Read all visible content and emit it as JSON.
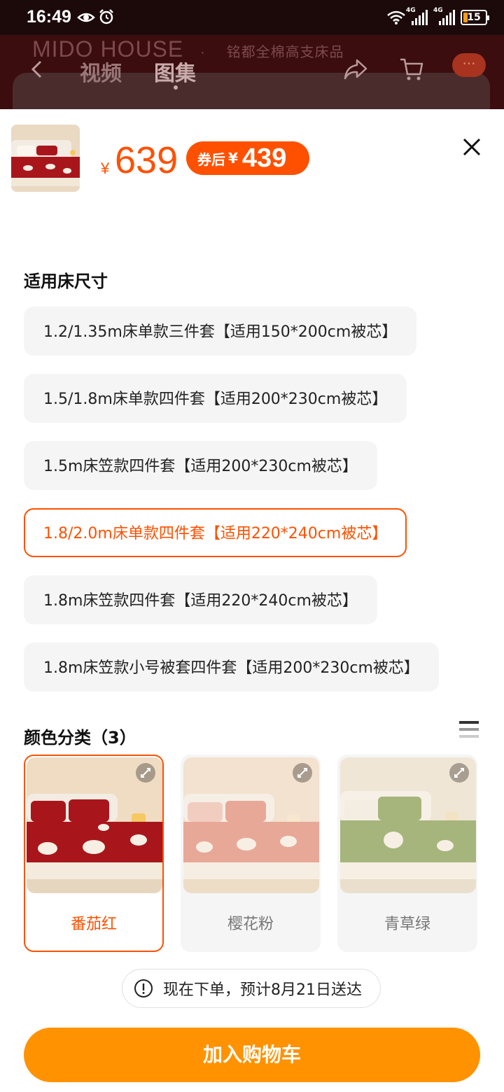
{
  "status_bar": {
    "time": "16:49",
    "net1": "4G",
    "net2": "4G",
    "battery": "15"
  },
  "background": {
    "brand": "MIDO HOUSE",
    "brand_sub": "铭都全棉高支床品",
    "tabs": [
      "视频",
      "图集"
    ],
    "more": "···"
  },
  "product": {
    "currency": "¥",
    "price": "639",
    "coupon_label": "券后",
    "coupon_currency": "¥",
    "coupon_price": "439"
  },
  "size_section": {
    "title": "适用床尺寸",
    "options": [
      {
        "label": "1.2/1.35m床单款三件套【适用150*200cm被芯】",
        "selected": false
      },
      {
        "label": "1.5/1.8m床单款四件套【适用200*230cm被芯】",
        "selected": false
      },
      {
        "label": "1.5m床笠款四件套【适用200*230cm被芯】",
        "selected": false
      },
      {
        "label": "1.8/2.0m床单款四件套【适用220*240cm被芯】",
        "selected": true
      },
      {
        "label": "1.8m床笠款四件套【适用220*240cm被芯】",
        "selected": false
      },
      {
        "label": "1.8m床笠款小号被套四件套【适用200*230cm被芯】",
        "selected": false
      }
    ]
  },
  "color_section": {
    "title": "颜色分类（3）",
    "options": [
      {
        "name": "番茄红",
        "selected": true,
        "color": "#a8161c"
      },
      {
        "name": "樱花粉",
        "selected": false,
        "color": "#e8a898"
      },
      {
        "name": "青草绿",
        "selected": false,
        "color": "#a6b57c"
      }
    ]
  },
  "eta": {
    "text": "现在下单，预计8月21日送达"
  },
  "add_to_cart": {
    "label": "加入购物车"
  },
  "colors": {
    "accent": "#ff5000",
    "cart_button": "#ff9200"
  }
}
